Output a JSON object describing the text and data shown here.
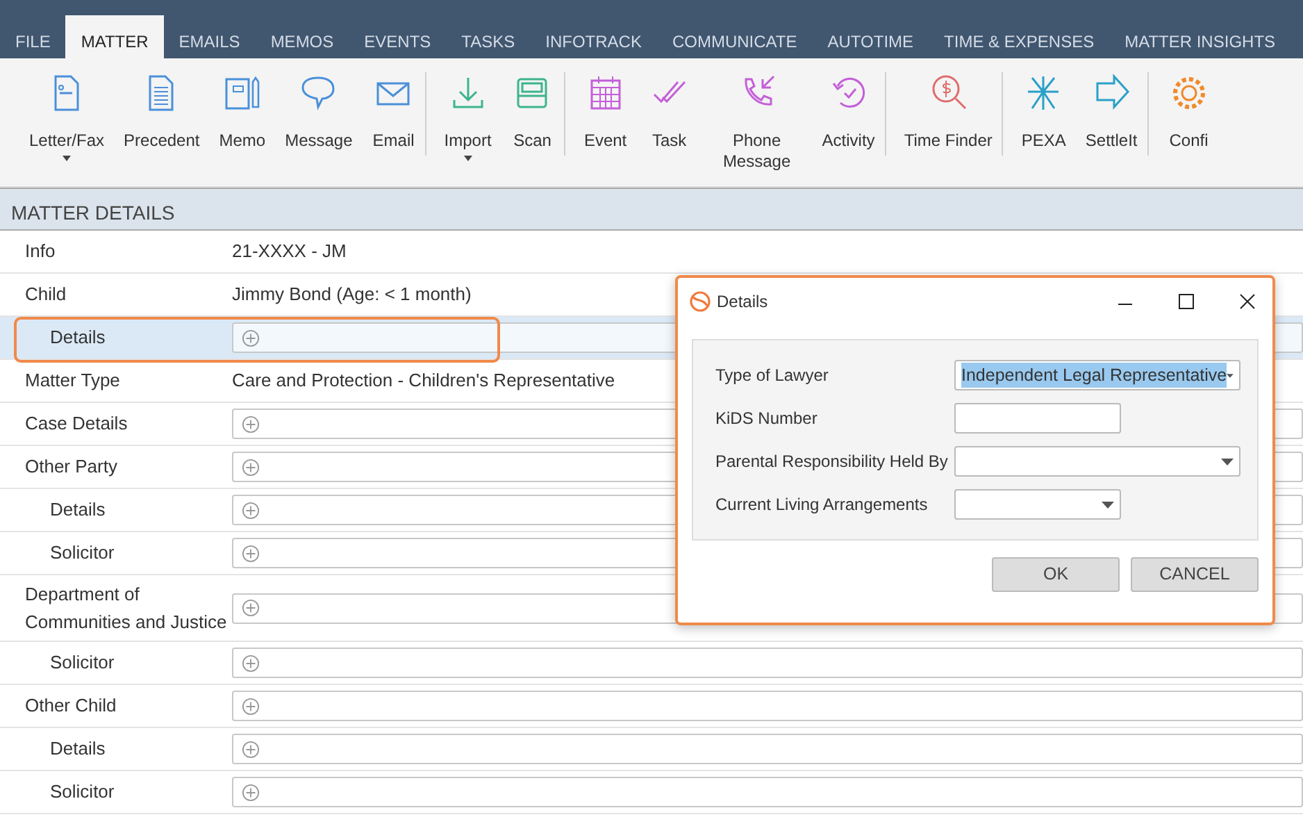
{
  "tabs": [
    {
      "label": "FILE",
      "selected": false
    },
    {
      "label": "MATTER",
      "selected": true
    },
    {
      "label": "EMAILS",
      "selected": false
    },
    {
      "label": "MEMOS",
      "selected": false
    },
    {
      "label": "EVENTS",
      "selected": false
    },
    {
      "label": "TASKS",
      "selected": false
    },
    {
      "label": "INFOTRACK",
      "selected": false
    },
    {
      "label": "COMMUNICATE",
      "selected": false
    },
    {
      "label": "AUTOTIME",
      "selected": false
    },
    {
      "label": "TIME & EXPENSES",
      "selected": false
    },
    {
      "label": "MATTER INSIGHTS",
      "selected": false
    }
  ],
  "ribbon": [
    {
      "kind": "letter",
      "label": "Letter/Fax",
      "dropdown": true
    },
    {
      "kind": "precedent",
      "label": "Precedent",
      "dropdown": false
    },
    {
      "kind": "memo",
      "label": "Memo",
      "dropdown": false
    },
    {
      "kind": "message",
      "label": "Message",
      "dropdown": false
    },
    {
      "kind": "email",
      "label": "Email",
      "dropdown": false,
      "separator_after": true
    },
    {
      "kind": "import",
      "label": "Import",
      "dropdown": true
    },
    {
      "kind": "scan",
      "label": "Scan",
      "dropdown": false,
      "separator_after": true
    },
    {
      "kind": "event",
      "label": "Event",
      "dropdown": false
    },
    {
      "kind": "task",
      "label": "Task",
      "dropdown": false
    },
    {
      "kind": "phone",
      "label": "Phone Message",
      "dropdown": false
    },
    {
      "kind": "activity",
      "label": "Activity",
      "dropdown": false,
      "separator_after": true
    },
    {
      "kind": "finder",
      "label": "Time Finder",
      "dropdown": false,
      "separator_after": true
    },
    {
      "kind": "pexa",
      "label": "PEXA",
      "dropdown": false
    },
    {
      "kind": "settle",
      "label": "SettleIt",
      "dropdown": false,
      "separator_after": true
    },
    {
      "kind": "config",
      "label": "Confi",
      "dropdown": false
    }
  ],
  "section": {
    "title": "MATTER DETAILS"
  },
  "rows": [
    {
      "label": "Info",
      "kind": "text",
      "value": "21-XXXX - JM",
      "selected": false
    },
    {
      "label": "Child",
      "kind": "text",
      "value": "Jimmy Bond (Age: < 1 month)",
      "selected": false,
      "children": [
        {
          "label": "Details",
          "kind": "field",
          "selected": true
        }
      ]
    },
    {
      "label": "Matter Type",
      "kind": "text",
      "value": "Care and Protection - Children's Representative",
      "selected": false
    },
    {
      "label": "Case Details",
      "kind": "field",
      "selected": false
    },
    {
      "label": "Other Party",
      "kind": "field",
      "selected": false,
      "children": [
        {
          "label": "Details",
          "kind": "field",
          "selected": false
        },
        {
          "label": "Solicitor",
          "kind": "field",
          "selected": false
        }
      ]
    },
    {
      "label": "Department of Communities and Justice",
      "kind": "field",
      "selected": false,
      "children": [
        {
          "label": "Solicitor",
          "kind": "field",
          "selected": false
        }
      ]
    },
    {
      "label": "Other Child",
      "kind": "field",
      "selected": false,
      "children": [
        {
          "label": "Details",
          "kind": "field",
          "selected": false
        },
        {
          "label": "Solicitor",
          "kind": "field",
          "selected": false
        }
      ]
    }
  ],
  "dialog": {
    "title": "Details",
    "fields": [
      {
        "label": "Type of Lawyer",
        "kind": "select",
        "value": "Independent Legal Representative",
        "text_selected": true
      },
      {
        "label": "KiDS Number",
        "kind": "text"
      },
      {
        "label": "Parental Responsibility Held By",
        "kind": "select"
      },
      {
        "label": "Current Living Arrangements",
        "kind": "select"
      }
    ],
    "buttons": [
      "OK",
      "CANCEL"
    ]
  }
}
